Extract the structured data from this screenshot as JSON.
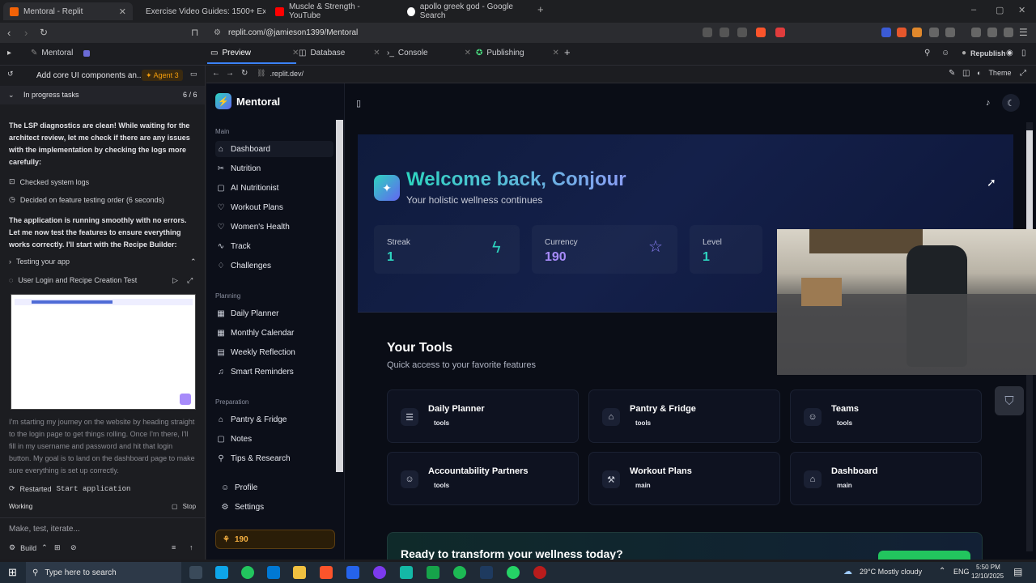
{
  "browser": {
    "tabs": [
      {
        "label": "Mentoral - Replit",
        "color": "#f26207"
      },
      {
        "label": "Exercise Video Guides: 1500+ Exerci",
        "color": "#3b82f6"
      },
      {
        "label": "Muscle & Strength - YouTube",
        "color": "#ff0000"
      },
      {
        "label": "apollo greek god - Google Search",
        "color": "#ffffff"
      }
    ],
    "url": "replit.com/@jamieson1399/Mentoral"
  },
  "replit": {
    "project": "Mentoral",
    "tabs": [
      "Preview",
      "Database",
      "Console",
      "Publishing"
    ],
    "search_icon": "search-icon",
    "republish": "Republish",
    "preview_url": ".replit.dev/",
    "theme": "Theme"
  },
  "agent": {
    "task_title": "Add core UI components an...",
    "agent_badge": "Agent 3",
    "progress_label": "In progress tasks",
    "progress_count": "6 / 6",
    "msg1": "The LSP diagnostics are clean! While waiting for the architect review, let me check if there are any issues with the implementation by checking the logs more carefully:",
    "step1": "Checked system logs",
    "step2": "Decided on feature testing order (6 seconds)",
    "msg2": "The application is running smoothly with no errors. Let me now test the features to ensure everything works correctly. I'll start with the Recipe Builder:",
    "testing": "Testing your app",
    "test_name": "User Login and Recipe Creation Test",
    "test_desc": "I'm starting my journey on the website by heading straight to the login page to get things rolling. Once I'm there, I'll fill in my username and password and hit that login button. My goal is to land on the dashboard page to make sure everything is set up correctly.",
    "restarted": "Restarted",
    "restarted_cmd": "Start application",
    "status": "Working",
    "stop": "Stop",
    "placeholder": "Make, test, iterate...",
    "build": "Build"
  },
  "app": {
    "brand": "Mentoral",
    "sections": [
      {
        "header": "Main",
        "items": [
          {
            "icon": "⌂",
            "label": "Dashboard"
          },
          {
            "icon": "✂",
            "label": "Nutrition"
          },
          {
            "icon": "▢",
            "label": "AI Nutritionist"
          },
          {
            "icon": "♡",
            "label": "Workout Plans"
          },
          {
            "icon": "♡",
            "label": "Women's Health"
          },
          {
            "icon": "∿",
            "label": "Track"
          },
          {
            "icon": "♢",
            "label": "Challenges"
          }
        ]
      },
      {
        "header": "Planning",
        "items": [
          {
            "icon": "▦",
            "label": "Daily Planner"
          },
          {
            "icon": "▦",
            "label": "Monthly Calendar"
          },
          {
            "icon": "▤",
            "label": "Weekly Reflection"
          },
          {
            "icon": "♫",
            "label": "Smart Reminders"
          }
        ]
      },
      {
        "header": "Preparation",
        "items": [
          {
            "icon": "⌂",
            "label": "Pantry & Fridge"
          },
          {
            "icon": "▢",
            "label": "Notes"
          },
          {
            "icon": "⚲",
            "label": "Tips & Research"
          }
        ]
      }
    ],
    "profile": "Profile",
    "settings": "Settings",
    "currency_badge": "190",
    "welcome": "Welcome back, Conjour",
    "subtitle": "Your holistic wellness continues",
    "stats": [
      {
        "label": "Streak",
        "value": "1"
      },
      {
        "label": "Currency",
        "value": "190"
      },
      {
        "label": "Level",
        "value": "1"
      }
    ],
    "tools_title": "Your Tools",
    "tools_subtitle": "Quick access to your favorite features",
    "tools": [
      {
        "icon": "☰",
        "title": "Daily Planner",
        "tag": "tools"
      },
      {
        "icon": "⌂",
        "title": "Pantry & Fridge",
        "tag": "tools"
      },
      {
        "icon": "☺",
        "title": "Teams",
        "tag": "tools"
      },
      {
        "icon": "☺",
        "title": "Accountability Partners",
        "tag": "tools"
      },
      {
        "icon": "⚒",
        "title": "Workout Plans",
        "tag": "main"
      },
      {
        "icon": "⌂",
        "title": "Dashboard",
        "tag": "main"
      }
    ],
    "cta": "Ready to transform your wellness today?"
  },
  "taskbar": {
    "search": "Type here to search",
    "weather": "29°C  Mostly cloudy",
    "lang": "ENG",
    "time": "5:50 PM",
    "date": "12/10/2025"
  }
}
